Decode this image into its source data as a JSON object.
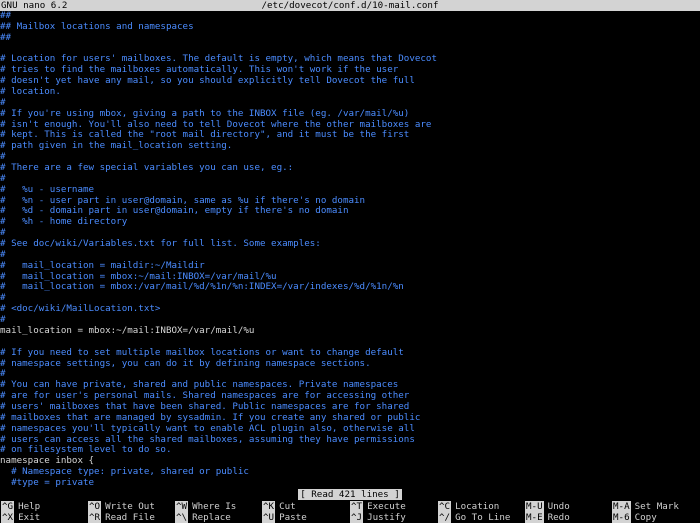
{
  "titlebar": {
    "app": "GNU nano 6.2",
    "file": "/etc/dovecot/conf.d/10-mail.conf"
  },
  "lines": [
    {
      "text": "##",
      "kind": "comment"
    },
    {
      "text": "## Mailbox locations and namespaces",
      "kind": "comment"
    },
    {
      "text": "##",
      "kind": "comment"
    },
    {
      "text": "",
      "kind": "code"
    },
    {
      "text": "# Location for users' mailboxes. The default is empty, which means that Dovecot",
      "kind": "comment"
    },
    {
      "text": "# tries to find the mailboxes automatically. This won't work if the user",
      "kind": "comment"
    },
    {
      "text": "# doesn't yet have any mail, so you should explicitly tell Dovecot the full",
      "kind": "comment"
    },
    {
      "text": "# location.",
      "kind": "comment"
    },
    {
      "text": "#",
      "kind": "comment"
    },
    {
      "text": "# If you're using mbox, giving a path to the INBOX file (eg. /var/mail/%u)",
      "kind": "comment"
    },
    {
      "text": "# isn't enough. You'll also need to tell Dovecot where the other mailboxes are",
      "kind": "comment"
    },
    {
      "text": "# kept. This is called the \"root mail directory\", and it must be the first",
      "kind": "comment"
    },
    {
      "text": "# path given in the mail_location setting.",
      "kind": "comment"
    },
    {
      "text": "#",
      "kind": "comment"
    },
    {
      "text": "# There are a few special variables you can use, eg.:",
      "kind": "comment"
    },
    {
      "text": "#",
      "kind": "comment"
    },
    {
      "text": "#   %u - username",
      "kind": "comment"
    },
    {
      "text": "#   %n - user part in user@domain, same as %u if there's no domain",
      "kind": "comment"
    },
    {
      "text": "#   %d - domain part in user@domain, empty if there's no domain",
      "kind": "comment"
    },
    {
      "text": "#   %h - home directory",
      "kind": "comment"
    },
    {
      "text": "#",
      "kind": "comment"
    },
    {
      "text": "# See doc/wiki/Variables.txt for full list. Some examples:",
      "kind": "comment"
    },
    {
      "text": "#",
      "kind": "comment"
    },
    {
      "text": "#   mail_location = maildir:~/Maildir",
      "kind": "comment"
    },
    {
      "text": "#   mail_location = mbox:~/mail:INBOX=/var/mail/%u",
      "kind": "comment"
    },
    {
      "text": "#   mail_location = mbox:/var/mail/%d/%1n/%n:INDEX=/var/indexes/%d/%1n/%n",
      "kind": "comment"
    },
    {
      "text": "#",
      "kind": "comment"
    },
    {
      "text": "# <doc/wiki/MailLocation.txt>",
      "kind": "comment"
    },
    {
      "text": "#",
      "kind": "comment"
    },
    {
      "text": "mail_location = mbox:~/mail:INBOX=/var/mail/%u",
      "kind": "code"
    },
    {
      "text": "",
      "kind": "code"
    },
    {
      "text": "# If you need to set multiple mailbox locations or want to change default",
      "kind": "comment"
    },
    {
      "text": "# namespace settings, you can do it by defining namespace sections.",
      "kind": "comment"
    },
    {
      "text": "#",
      "kind": "comment"
    },
    {
      "text": "# You can have private, shared and public namespaces. Private namespaces",
      "kind": "comment"
    },
    {
      "text": "# are for user's personal mails. Shared namespaces are for accessing other",
      "kind": "comment"
    },
    {
      "text": "# users' mailboxes that have been shared. Public namespaces are for shared",
      "kind": "comment"
    },
    {
      "text": "# mailboxes that are managed by sysadmin. If you create any shared or public",
      "kind": "comment"
    },
    {
      "text": "# namespaces you'll typically want to enable ACL plugin also, otherwise all",
      "kind": "comment"
    },
    {
      "text": "# users can access all the shared mailboxes, assuming they have permissions",
      "kind": "comment"
    },
    {
      "text": "# on filesystem level to do so.",
      "kind": "comment"
    },
    {
      "text": "namespace inbox {",
      "kind": "code"
    },
    {
      "text": "  # Namespace type: private, shared or public",
      "kind": "comment"
    },
    {
      "text": "  #type = private",
      "kind": "comment"
    }
  ],
  "status": "[ Read 421 lines ]",
  "shortcuts": [
    {
      "key": "^G",
      "label": "Help"
    },
    {
      "key": "^X",
      "label": "Exit"
    },
    {
      "key": "^O",
      "label": "Write Out"
    },
    {
      "key": "^R",
      "label": "Read File"
    },
    {
      "key": "^W",
      "label": "Where Is"
    },
    {
      "key": "^\\",
      "label": "Replace"
    },
    {
      "key": "^K",
      "label": "Cut"
    },
    {
      "key": "^U",
      "label": "Paste"
    },
    {
      "key": "^T",
      "label": "Execute"
    },
    {
      "key": "^J",
      "label": "Justify"
    },
    {
      "key": "^C",
      "label": "Location"
    },
    {
      "key": "^/",
      "label": "Go To Line"
    },
    {
      "key": "M-U",
      "label": "Undo"
    },
    {
      "key": "M-E",
      "label": "Redo"
    },
    {
      "key": "M-A",
      "label": "Set Mark"
    },
    {
      "key": "M-6",
      "label": "Copy"
    }
  ]
}
